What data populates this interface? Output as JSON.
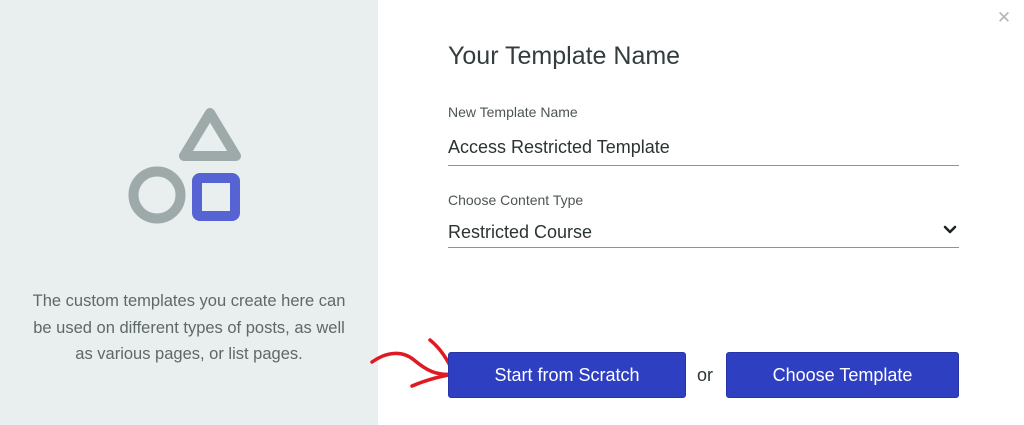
{
  "dialog": {
    "title": "Your Template Name",
    "close_symbol": "✕"
  },
  "left_panel": {
    "illustration_icons": [
      "triangle-shape",
      "circle-shape",
      "square-shape"
    ],
    "description": "The custom templates you create here can be used on different types of posts, as well as various pages, or list pages."
  },
  "form": {
    "name_label": "New Template Name",
    "name_value": "Access Restricted Template",
    "type_label": "Choose Content Type",
    "type_value": "Restricted Course"
  },
  "actions": {
    "scratch_label": "Start from Scratch",
    "or_text": "or",
    "template_label": "Choose Template"
  },
  "colors": {
    "left_panel_bg": "#e9eeee",
    "shape_gray": "#9ea9a9",
    "shape_blue": "#5563d3",
    "button_blue": "#2f3fc2",
    "annotation_red": "#e01a22"
  }
}
